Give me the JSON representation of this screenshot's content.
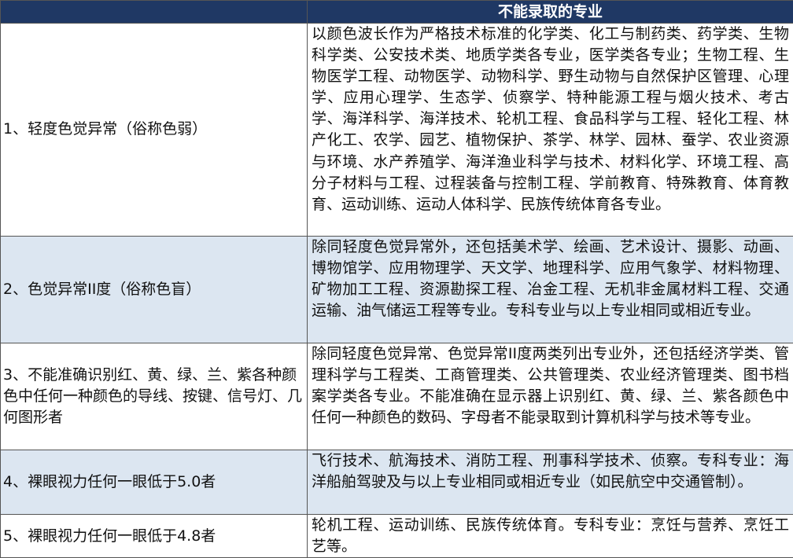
{
  "table": {
    "header": {
      "col1": "",
      "col2": "不能录取的专业"
    },
    "rows": [
      {
        "condition": "1、轻度色觉异常（俗称色弱）",
        "majors": "以颜色波长作为严格技术标准的化学类、化工与制药类、药学类、生物科学类、公安技术类、地质学类各专业，医学类各专业；生物工程、生物医学工程、动物医学、动物科学、野生动物与自然保护区管理、心理学、应用心理学、生态学、侦察学、特种能源工程与烟火技术、考古学、海洋科学、海洋技术、轮机工程、食品科学与工程、轻化工程、林产化工、农学、园艺、植物保护、茶学、林学、园林、蚕学、农业资源与环境、水产养殖学、海洋渔业科学与技术、材料化学、环境工程、高分子材料与工程、过程装备与控制工程、学前教育、特殊教育、体育教育、运动训练、运动人体科学、民族传统体育各专业。"
      },
      {
        "condition": "2、色觉异常II度（俗称色盲）",
        "majors": "除同轻度色觉异常外，还包括美术学、绘画、艺术设计、摄影、动画、博物馆学、应用物理学、天文学、地理科学、应用气象学、材料物理、矿物加工工程、资源勘探工程、冶金工程、无机非金属材料工程、交通运输、油气储运工程等专业。专科专业与以上专业相同或相近专业。"
      },
      {
        "condition": "3、不能准确识别红、黄、绿、兰、紫各种颜色中任何一种颜色的导线、按键、信号灯、几何图形者",
        "majors": "除同轻度色觉异常、色觉异常II度两类列出专业外，还包括经济学类、管理科学与工程类、工商管理类、公共管理类、农业经济管理类、图书档案学类各专业。不能准确在显示器上识别红、黄、绿、兰、紫各颜色中任何一种颜色的数码、字母者不能录取到计算机科学与技术等专业。"
      },
      {
        "condition": "4、裸眼视力任何一眼低于5.0者",
        "majors": "飞行技术、航海技术、消防工程、刑事科学技术、侦察。专科专业：海洋船舶驾驶及与以上专业相同或相近专业（如民航空中交通管制）。"
      },
      {
        "condition": "5、裸眼视力任何一眼低于4.8者",
        "majors": "轮机工程、运动训练、民族传统体育。专科专业：烹饪与营养、烹饪工艺等。"
      }
    ]
  }
}
